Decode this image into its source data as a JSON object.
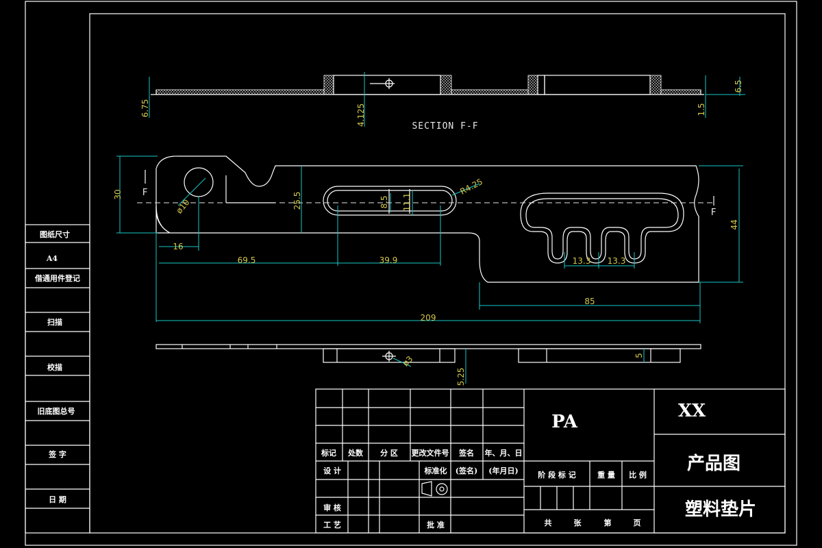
{
  "section": {
    "label": "SECTION F-F",
    "marker_left": "F",
    "marker_right": "F"
  },
  "dimensions": {
    "d675": "6.75",
    "d4125": "4.125",
    "d15": "1.5",
    "d65": "6.5",
    "d30": "30",
    "d255": "25.5",
    "dphi10": "ø10",
    "d16": "16",
    "d695": "69.5",
    "d399": "39.9",
    "d85": "8.5",
    "d111": "11.1",
    "dr425": "R4.25",
    "d133a": "13.3",
    "d133b": "13.3",
    "d44": "44",
    "d85b": "85",
    "d209": "209",
    "dphi3": "ø3",
    "d525": "5.25",
    "d5": "5"
  },
  "side_column": {
    "cells": [
      "图纸尺寸",
      "A4",
      "借通用件登记",
      "扫描",
      "校描",
      "旧底图总号",
      "签  字",
      "日  期"
    ]
  },
  "title_block": {
    "header_row": [
      "标记",
      "处数",
      "分  区",
      "更改文件号",
      "签名",
      "年、月、日"
    ],
    "design": "设  计",
    "standardize": "标准化",
    "sign": "(签名)",
    "date": "(年月日)",
    "review": "审  核",
    "process": "工  艺",
    "approve": "批  准",
    "stage_row": [
      "阶  段  标  记",
      "重  量",
      "比  例"
    ],
    "sheet_row": [
      "共",
      "张",
      "第",
      "页"
    ],
    "material": "PA",
    "company": "XX",
    "drawing_type": "产品图",
    "part_name": "塑料垫片"
  }
}
